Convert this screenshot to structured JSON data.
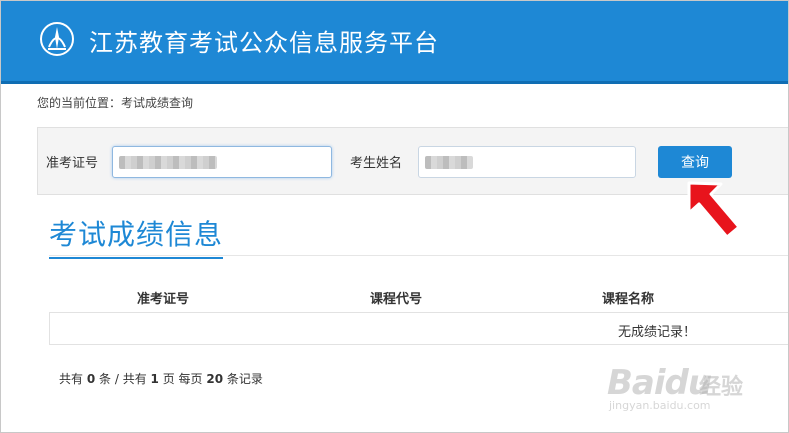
{
  "header": {
    "site_title": "江苏教育考试公众信息服务平台",
    "logo_icon": "education-emblem-icon",
    "background_color": "#1e88d5"
  },
  "breadcrumb": {
    "text": "您的当前位置：考试成绩查询"
  },
  "search": {
    "ticket_label": "准考证号",
    "name_label": "考生姓名",
    "query_button": "查询"
  },
  "section": {
    "title": "考试成绩信息"
  },
  "table": {
    "columns": [
      "准考证号",
      "课程代号",
      "课程名称"
    ],
    "empty_message": "无成绩记录！"
  },
  "pager": {
    "prefix": "共有",
    "total_count": "0",
    "unit_items": "条 / 共有",
    "total_pages": "1",
    "unit_pages": "页 每页",
    "per_page": "20",
    "suffix": "条记录"
  },
  "annotation": {
    "arrow_icon": "red-pointer-arrow-icon",
    "arrow_color": "#e8141c"
  },
  "watermark": {
    "logo": "Baidu",
    "label": "经验",
    "url": "jingyan.baidu.com"
  }
}
